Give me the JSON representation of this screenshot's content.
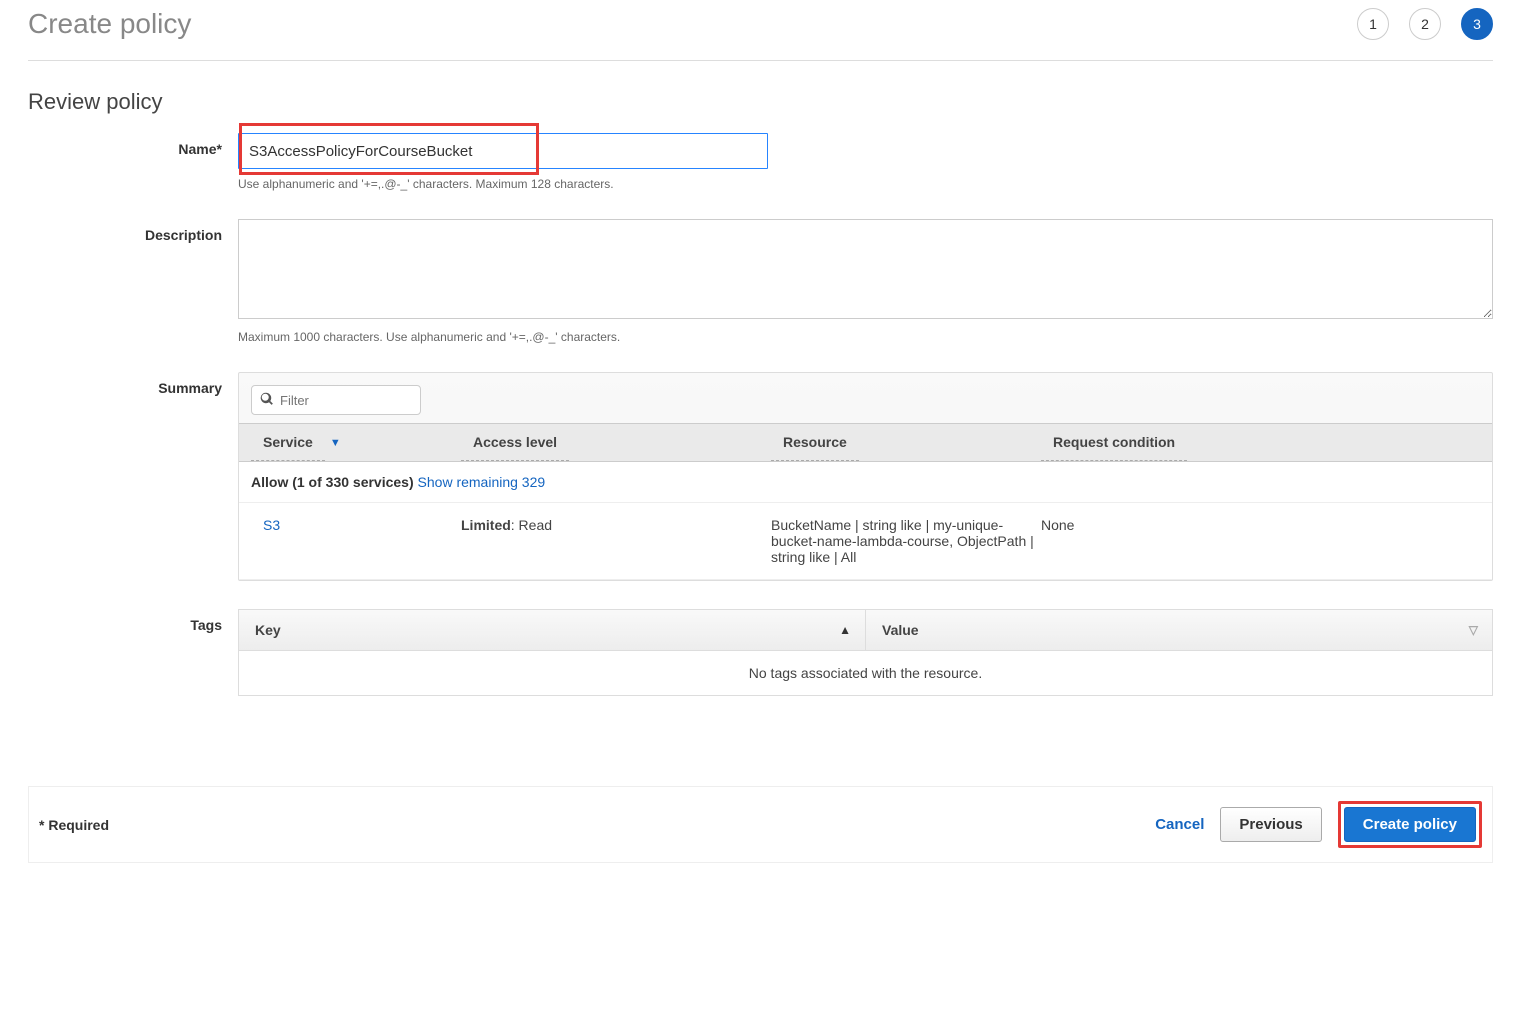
{
  "header": {
    "title": "Create policy"
  },
  "steps": {
    "s1": "1",
    "s2": "2",
    "s3": "3",
    "active": 3
  },
  "section_title": "Review policy",
  "form": {
    "name_label": "Name*",
    "name_value": "S3AccessPolicyForCourseBucket",
    "name_help": "Use alphanumeric and '+=,.@-_' characters. Maximum 128 characters.",
    "desc_label": "Description",
    "desc_value": "",
    "desc_help": "Maximum 1000 characters. Use alphanumeric and '+=,.@-_' characters.",
    "summary_label": "Summary",
    "tags_label": "Tags"
  },
  "summary": {
    "filter_placeholder": "Filter",
    "columns": {
      "service": "Service",
      "access": "Access level",
      "resource": "Resource",
      "reqcond": "Request condition"
    },
    "allow_prefix": "Allow (1 of 330 services) ",
    "show_link": "Show remaining 329",
    "row": {
      "service": "S3",
      "access_bold": "Limited",
      "access_rest": ": Read",
      "resource": "BucketName | string like | my-unique-bucket-name-lambda-course, ObjectPath | string like | All",
      "reqcond": "None"
    }
  },
  "tags": {
    "key_header": "Key",
    "value_header": "Value",
    "empty": "No tags associated with the resource."
  },
  "footer": {
    "required": "* Required",
    "cancel": "Cancel",
    "previous": "Previous",
    "create": "Create policy"
  }
}
